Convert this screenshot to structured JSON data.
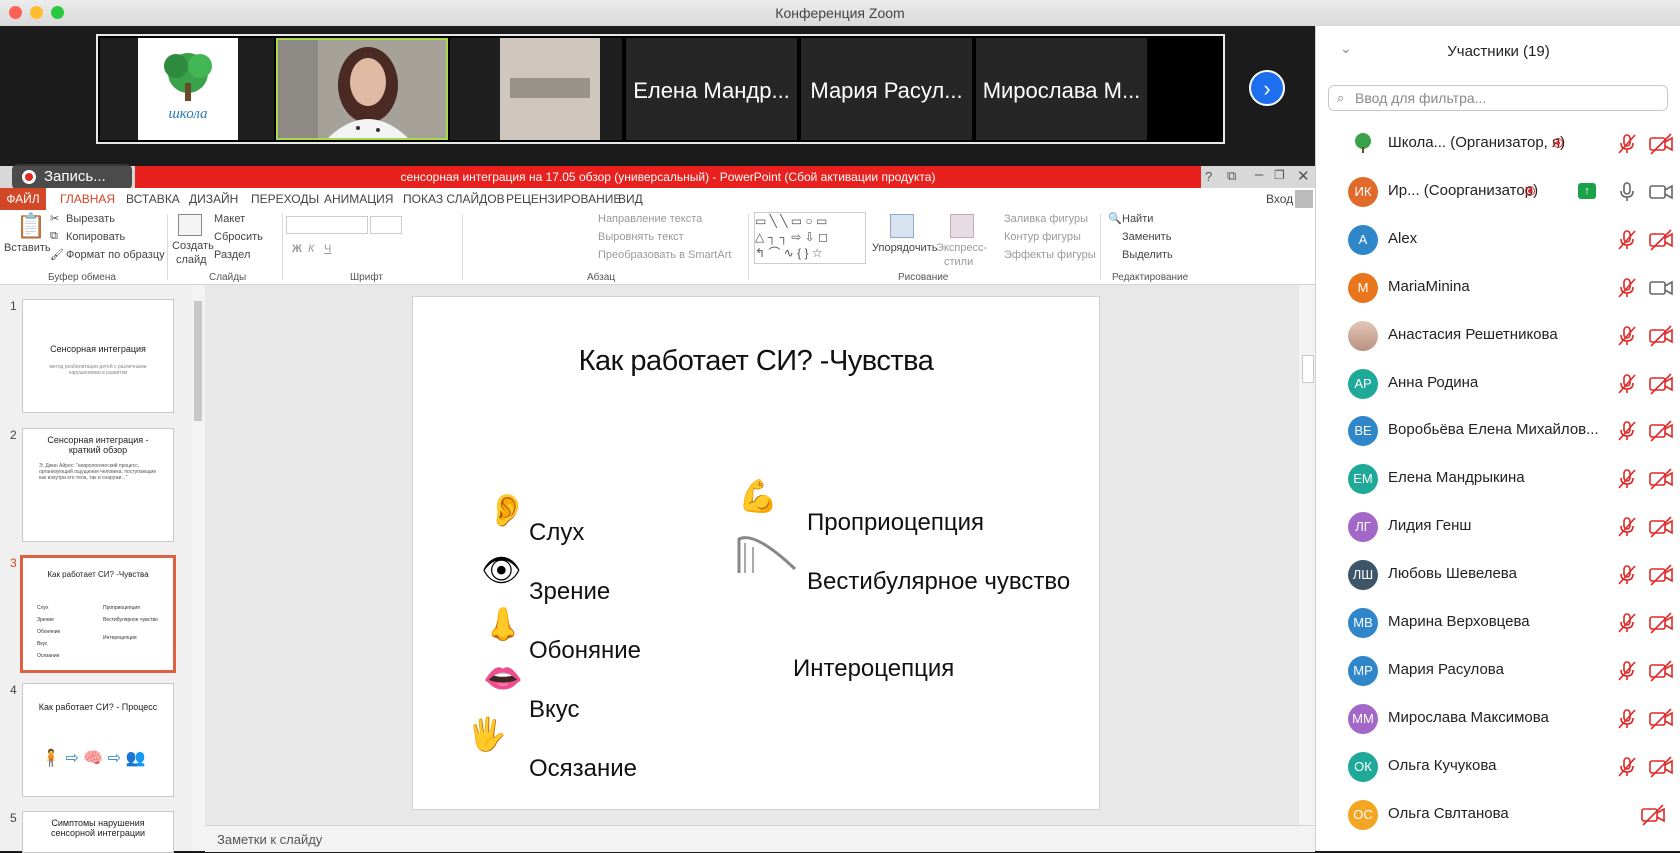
{
  "window": {
    "title": "Конференция Zoom"
  },
  "gallery": {
    "tiles": [
      {
        "name": "",
        "kind": "logo",
        "logo_text": "школа"
      },
      {
        "name": "",
        "kind": "video-speaker"
      },
      {
        "name": "",
        "kind": "video-room"
      },
      {
        "name": "Елена Мандр..."
      },
      {
        "name": "Мария Расул..."
      },
      {
        "name": "Мирослава М..."
      }
    ],
    "next_icon": "chevron-right-icon"
  },
  "recording": {
    "label": "Запись..."
  },
  "powerpoint": {
    "title": "сенсорная интеграция на 17.05 обзор (универсальный) -  PowerPoint (Сбой активации продукта)",
    "login": "Вход",
    "tabs": [
      "ФАЙЛ",
      "ГЛАВНАЯ",
      "ВСТАВКА",
      "ДИЗАЙН",
      "ПЕРЕХОДЫ",
      "АНИМАЦИЯ",
      "ПОКАЗ СЛАЙДОВ",
      "РЕЦЕНЗИРОВАНИЕ",
      "ВИД"
    ],
    "ribbon": {
      "paste": "Вставить",
      "cut": "Вырезать",
      "copy": "Копировать",
      "format_painter": "Формат по образцу",
      "group_clipboard": "Буфер обмена",
      "create_slide": "Создать",
      "create_slide2": "слайд",
      "layout": "Макет",
      "reset": "Сбросить",
      "section": "Раздел",
      "group_slides": "Слайды",
      "group_font": "Шрифт",
      "text_direction": "Направление текста",
      "align_text": "Выровнять текст",
      "smartart": "Преобразовать в SmartArt",
      "group_paragraph": "Абзац",
      "arrange": "Упорядочить",
      "quick_styles": "Экспресс-",
      "quick_styles2": "стили",
      "fill": "Заливка фигуры",
      "outline": "Контур фигуры",
      "effects": "Эффекты фигуры",
      "group_drawing": "Рисование",
      "find": "Найти",
      "replace": "Заменить",
      "select": "Выделить",
      "group_editing": "Редактирование"
    },
    "thumbnails": [
      {
        "num": "1",
        "title": "Сенсорная интеграция",
        "sub": "метод реабилитации детей с различными нарушениями в развитии"
      },
      {
        "num": "2",
        "title": "Сенсорная интеграция - краткий обзор",
        "sub": "Э. Джин Айрес: \"неврологический процесс, организующий ощущения человека, поступающие как изнутри его тела, так и снаружи...\""
      },
      {
        "num": "3",
        "title": "Как работает СИ? -Чувства",
        "sub": ""
      },
      {
        "num": "4",
        "title": "Как работает СИ? - Процесс",
        "sub": ""
      },
      {
        "num": "5",
        "title": "Симптомы нарушения сенсорной интеграции",
        "sub": ""
      }
    ],
    "slide": {
      "title": "Как работает СИ? -Чувства",
      "senses_left": [
        "Слух",
        "Зрение",
        "Обоняние",
        "Вкус",
        "Осязание"
      ],
      "senses_right": [
        "Проприоцепция",
        "Вестибулярное чувство",
        "Интероцепция"
      ]
    },
    "notes_placeholder": "Заметки к слайду"
  },
  "participants": {
    "title": "Участники (19)",
    "filter_placeholder": "Ввод для фильтра...",
    "list": [
      {
        "initials": "",
        "name": "Школа...  (Организатор, я)",
        "color": "#ffffff",
        "mic": "muted",
        "cam": "off"
      },
      {
        "initials": "ИК",
        "name": "Ир...   (Соорганизатор)",
        "color": "#e06a2a",
        "mic": "on",
        "cam": "on"
      },
      {
        "initials": "A",
        "name": "Alex",
        "color": "#2f86c9",
        "mic": "muted",
        "cam": "off"
      },
      {
        "initials": "M",
        "name": "MariaMinina",
        "color": "#e9761c",
        "mic": "muted",
        "cam": "on"
      },
      {
        "initials": "",
        "name": "Анастасия Решетникова",
        "color": "#c9a99a",
        "mic": "muted",
        "cam": "off"
      },
      {
        "initials": "АР",
        "name": "Анна Родина",
        "color": "#1ea999",
        "mic": "muted",
        "cam": "off"
      },
      {
        "initials": "ВЕ",
        "name": "Воробьёва Елена Михайлов...",
        "color": "#2f86c9",
        "mic": "muted",
        "cam": "off"
      },
      {
        "initials": "ЕМ",
        "name": "Елена Мандрыкина",
        "color": "#1ea999",
        "mic": "muted",
        "cam": "off"
      },
      {
        "initials": "ЛГ",
        "name": "Лидия Генш",
        "color": "#a367c7",
        "mic": "muted",
        "cam": "off"
      },
      {
        "initials": "ЛШ",
        "name": "Любовь Шевелева",
        "color": "#3d5568",
        "mic": "muted",
        "cam": "off"
      },
      {
        "initials": "МВ",
        "name": "Марина Верховцева",
        "color": "#2f86c9",
        "mic": "muted",
        "cam": "off"
      },
      {
        "initials": "МР",
        "name": "Мария Расулова",
        "color": "#2f86c9",
        "mic": "muted",
        "cam": "off"
      },
      {
        "initials": "ММ",
        "name": "Мирослава Максимова",
        "color": "#a367c7",
        "mic": "muted",
        "cam": "off"
      },
      {
        "initials": "ОК",
        "name": "Ольга Кучукова",
        "color": "#1ea999",
        "mic": "muted",
        "cam": "off"
      },
      {
        "initials": "ОС",
        "name": "Ольга Свлтанова",
        "color": "#f2a623",
        "mic": "none",
        "cam": "off"
      }
    ]
  }
}
